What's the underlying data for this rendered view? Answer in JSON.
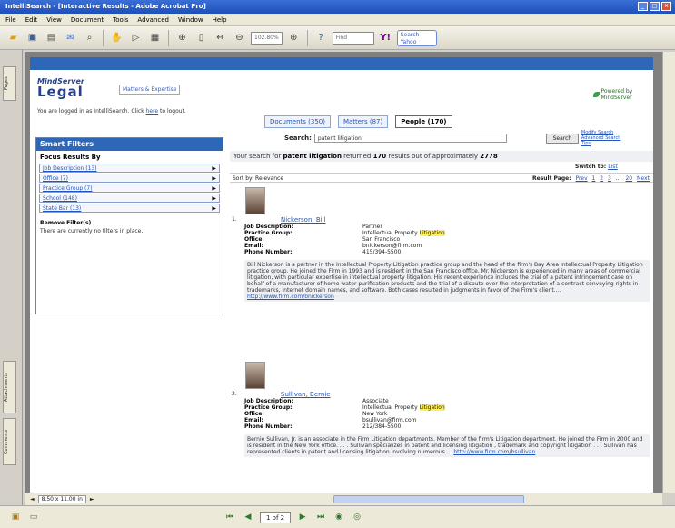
{
  "window": {
    "title": "IntelliSearch - [Interactive Results - Adobe Acrobat Pro]"
  },
  "menu": [
    "File",
    "Edit",
    "View",
    "Document",
    "Tools",
    "Advanced",
    "Window",
    "Help"
  ],
  "toolbar": {
    "zoom": "102.80%",
    "find_placeholder": "Find",
    "yahoo": "Search Yahoo"
  },
  "rail_tabs": {
    "pages": "Pages",
    "attachments": "Attachments",
    "comments": "Comments"
  },
  "brand": {
    "mark": "MindServer",
    "name": "Legal",
    "tagline": "Matters & Expertise",
    "right": "Powered by MindServer"
  },
  "login": {
    "text": "You are logged in as IntelliSearch. Click",
    "link": "here",
    "text2": "to logout."
  },
  "smart_filters": {
    "title": "Smart Filters",
    "focus": "Focus Results By",
    "items": [
      "Job Description (13)",
      "Office (7)",
      "Practice Group (7)",
      "School (148)",
      "State Bar (13)"
    ],
    "remove_title": "Remove Filter(s)",
    "remove_text": "There are currently no filters in place."
  },
  "tabs": [
    "Documents (350)",
    "Matters (87)",
    "People (170)"
  ],
  "search": {
    "label": "Search:",
    "value": "patent litigation",
    "button": "Search",
    "advanced": "Modify Search Advanced Search Tips"
  },
  "summary": {
    "pre": "Your search for",
    "query": "patent litigation",
    "mid": "returned",
    "count": "170",
    "post": "results out of approximately",
    "total": "2778"
  },
  "switch": {
    "label": "Switch to:",
    "link": "List"
  },
  "sort": {
    "label": "Sort by: Relevance",
    "result_page": "Result Page:",
    "prev": "Prev",
    "pages": [
      "1",
      "2",
      "3",
      "...",
      "20"
    ],
    "next": "Next"
  },
  "results": [
    {
      "num": "1.",
      "name": "Nickerson, Bill",
      "fields": [
        [
          "Job Description:",
          "Partner"
        ],
        [
          "Practice Group:",
          "Intellectual Property Litigation"
        ],
        [
          "Office:",
          "San Francisco"
        ],
        [
          "Email:",
          "bnickerson@firm.com"
        ],
        [
          "Phone Number:",
          "415/394-5500"
        ]
      ],
      "bio": "Bill Nickerson is a partner in the Intellectual Property Litigation practice group and the head of the firm's Bay Area Intellectual Property Litigation practice group. He joined the Firm in 1993 and is resident in the San Francisco office. Mr. Nickerson is experienced in many areas of commercial litigation, with particular expertise in intellectual property litigation. His recent experience includes the trial of a patent infringement case on behalf of a manufacturer of home water purification products and the trial of a dispute over the interpretation of a contract conveying rights in trademarks, Internet domain names, and software. Both cases resulted in judgments in favor of the Firm's client....",
      "url": "http://www.firm.com/bnickerson"
    },
    {
      "num": "2.",
      "name": "Sullivan, Bernie",
      "fields": [
        [
          "Job Description:",
          "Associate"
        ],
        [
          "Practice Group:",
          "Intellectual Property Litigation"
        ],
        [
          "Office:",
          "New York"
        ],
        [
          "Email:",
          "bsullivan@firm.com"
        ],
        [
          "Phone Number:",
          "212/384-5500"
        ]
      ],
      "bio": "Bernie Sullivan, Jr. is an associate in the Firm Litigation departments. Member of the firm's Litigation department. He joined the Firm in 2000 and is resident in the New York office. . . . Sullivan specializes in patent and licensing litigation , trademark and copyright litigation . . . Sullivan has represented clients in patent and licensing litigation involving numerous ...",
      "url": "http://www.firm.com/bsullivan"
    }
  ],
  "hscroll": {
    "zoom": "8.50 x 11.00 in"
  },
  "status": {
    "page": "1 of 2"
  },
  "colors": {
    "accent": "#2e67b8",
    "highlight": "#ffef5a"
  }
}
